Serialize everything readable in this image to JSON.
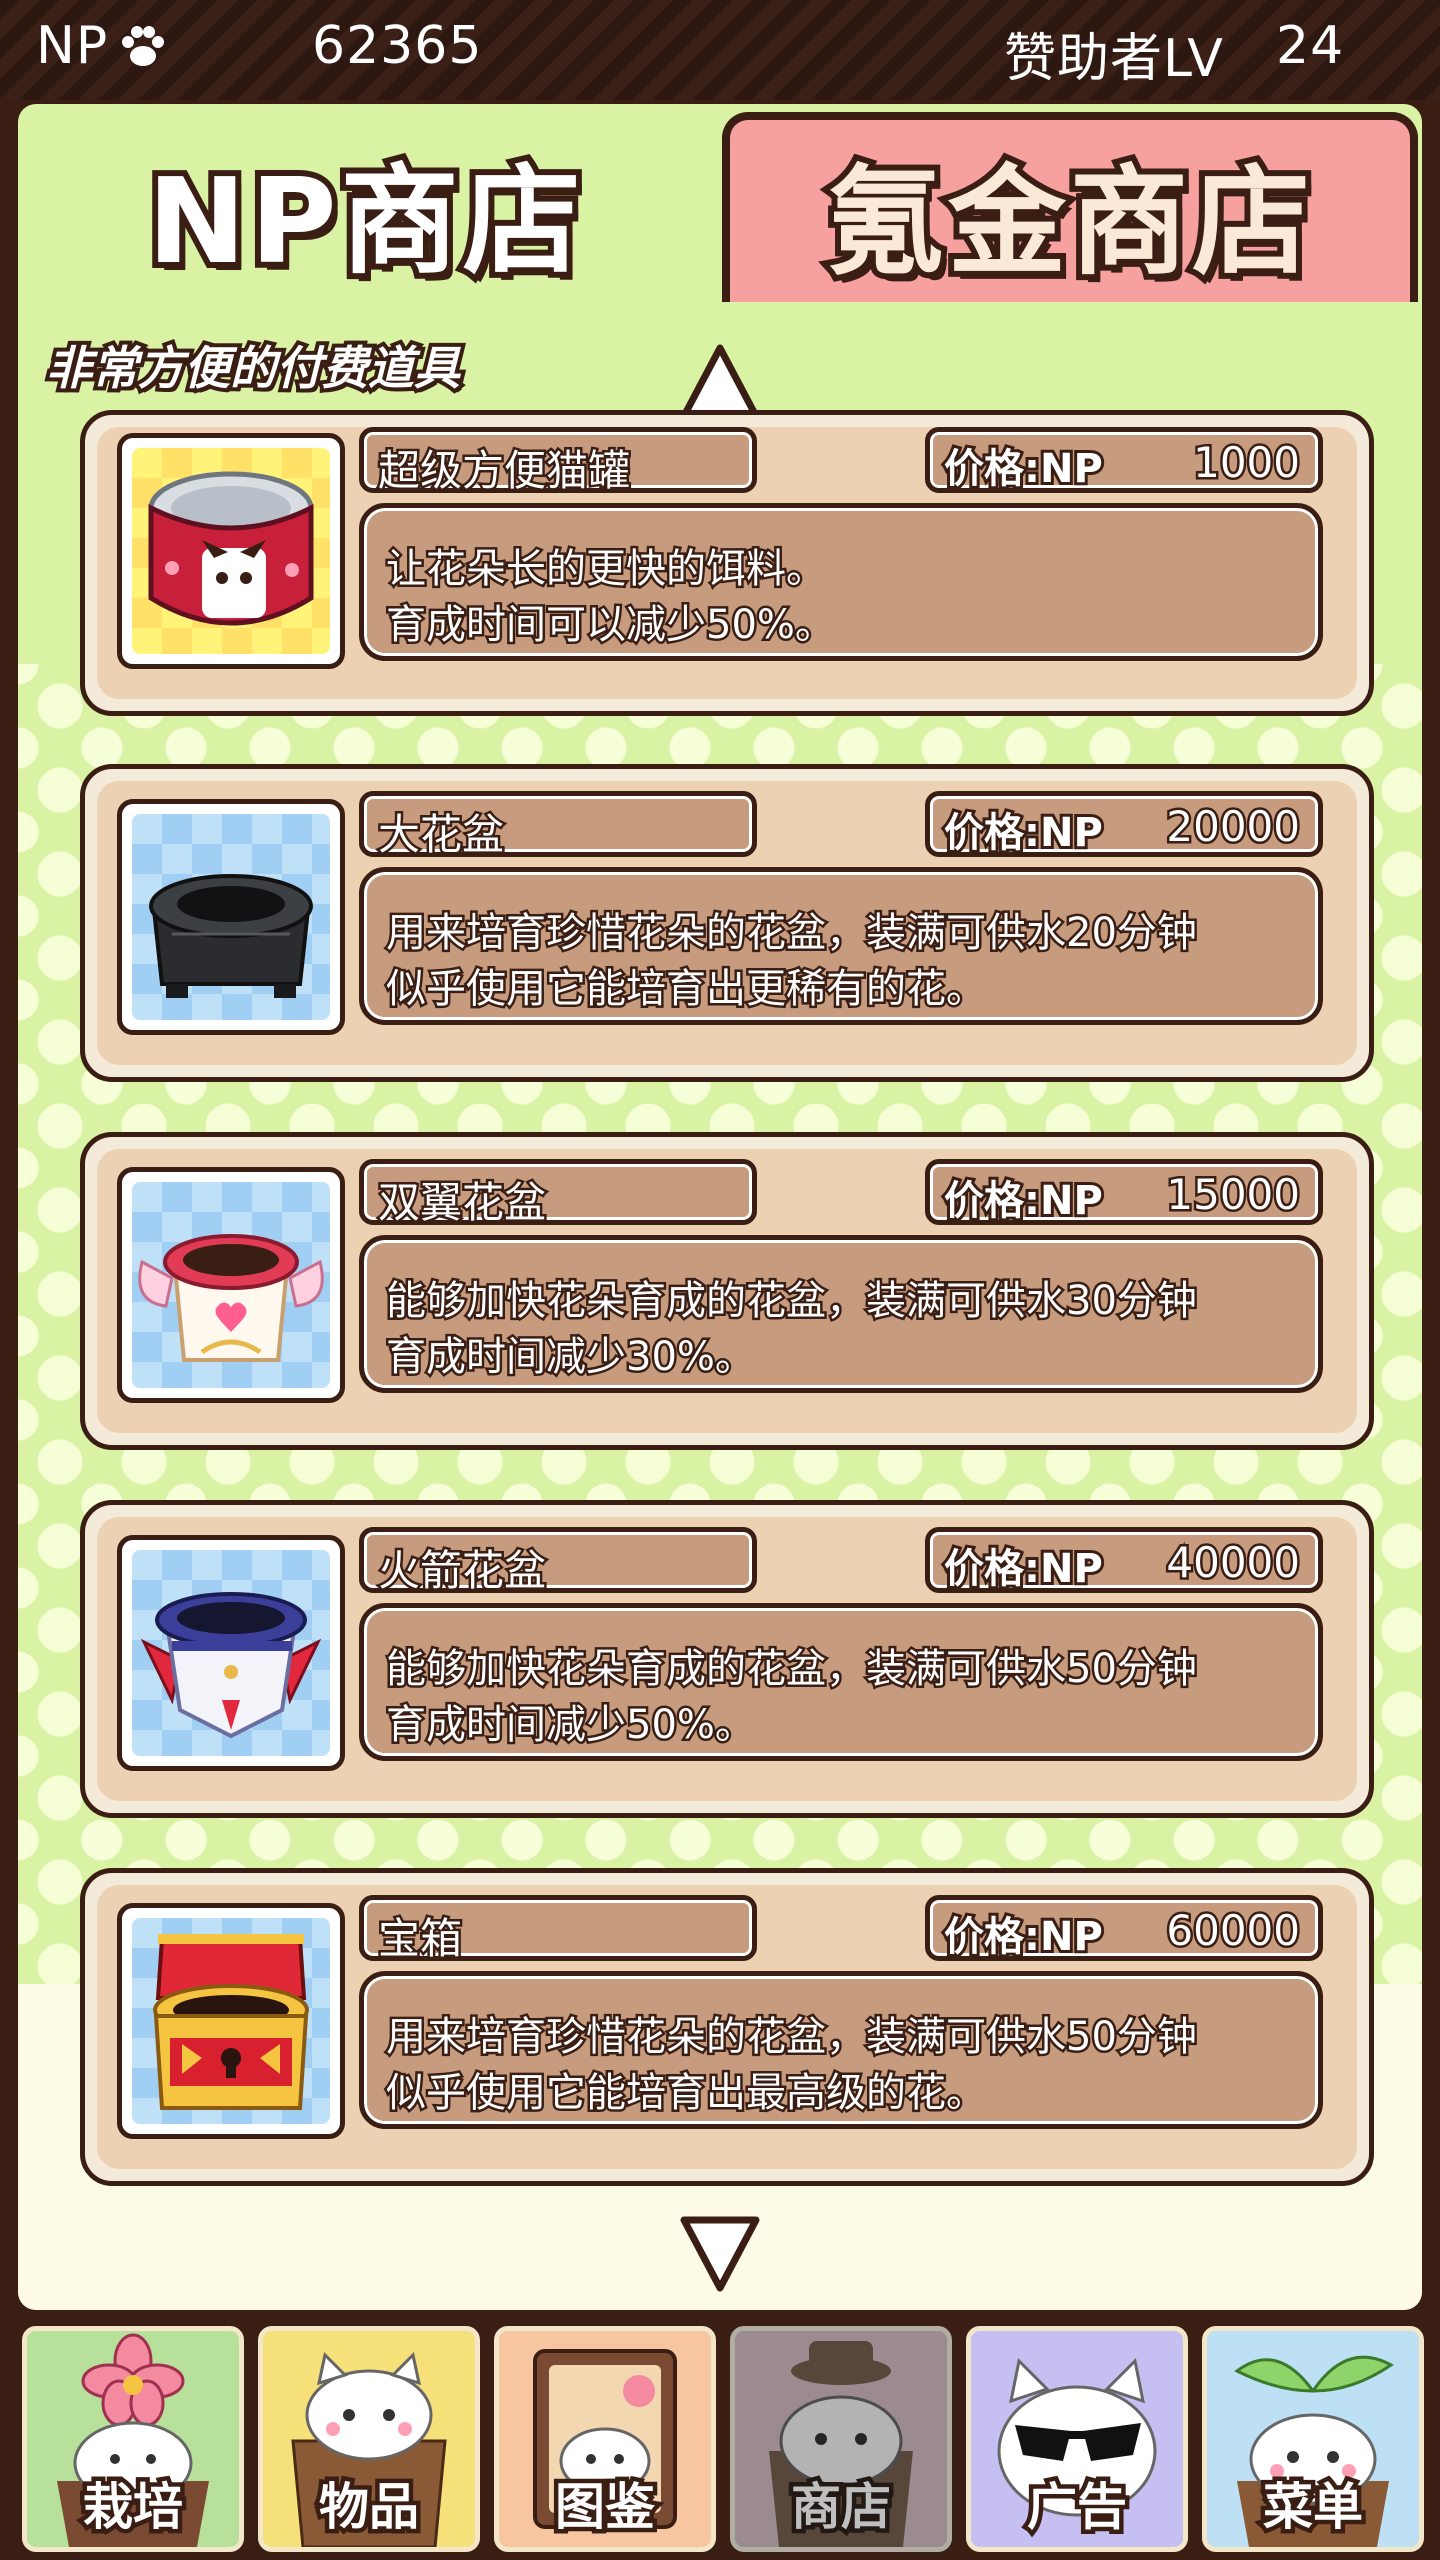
{
  "status": {
    "np_label": "NP",
    "np_value": "62365",
    "sponsor_label": "赞助者LV",
    "sponsor_level": "24"
  },
  "tabs": {
    "np_shop": "NP商店",
    "krypton_shop": "氪金商店"
  },
  "subtitle": "非常方便的付费道具",
  "price_label": "价格:NP",
  "items": [
    {
      "name": "超级方便猫罐",
      "price": "1000",
      "desc1": "让花朵长的更快的饵料。",
      "desc2": "育成时间可以减少50%。",
      "icon": "cat-can-icon"
    },
    {
      "name": "大花盆",
      "price": "20000",
      "desc1": "用来培育珍惜花朵的花盆，装满可供水20分钟",
      "desc2": "似乎使用它能培育出更稀有的花。",
      "icon": "black-pot-icon"
    },
    {
      "name": "双翼花盆",
      "price": "15000",
      "desc1": "能够加快花朵育成的花盆，装满可供水30分钟",
      "desc2": "育成时间减少30%。",
      "icon": "winged-pot-icon"
    },
    {
      "name": "火箭花盆",
      "price": "40000",
      "desc1": "能够加快花朵育成的花盆，装满可供水50分钟",
      "desc2": "育成时间减少50%。",
      "icon": "rocket-pot-icon"
    },
    {
      "name": "宝箱",
      "price": "60000",
      "desc1": "用来培育珍惜花朵的花盆，装满可供水50分钟",
      "desc2": "似乎使用它能培育出最高级的花。",
      "icon": "treasure-chest-icon"
    }
  ],
  "nav": [
    {
      "label": "栽培",
      "icon": "flower-cat-icon"
    },
    {
      "label": "物品",
      "icon": "bag-cat-icon"
    },
    {
      "label": "图鉴",
      "icon": "book-cat-icon"
    },
    {
      "label": "商店",
      "icon": "shop-cat-icon",
      "active": true
    },
    {
      "label": "广告",
      "icon": "sunglasses-cat-icon"
    },
    {
      "label": "菜单",
      "icon": "sprout-cat-icon"
    }
  ],
  "colors": {
    "frame": "#3a1e14",
    "panel_green": "#d9f2a4",
    "krypton_tab": "#f6a0a0",
    "card": "#ecd2b3",
    "box": "#c79b7d"
  }
}
